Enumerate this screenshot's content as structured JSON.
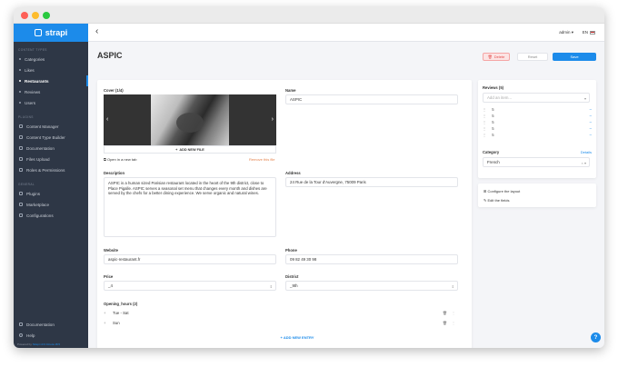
{
  "sidebar": {
    "brand": "strapi",
    "sections": {
      "content_types": "CONTENT TYPES",
      "plugins": "PLUGINS",
      "general": "GENERAL"
    },
    "content_types": [
      "Categories",
      "Likes",
      "Restaurants",
      "Reviews",
      "Users"
    ],
    "plugins": [
      "Content Manager",
      "Content Type Builder",
      "Documentation",
      "Files Upload",
      "Roles & Permissions"
    ],
    "general": [
      "Plugins",
      "Marketplace",
      "Configurations"
    ],
    "bottom": [
      "Documentation",
      "Help"
    ],
    "powered_prefix": "Powered by",
    "powered_link": "Strapi v3.0.0-beta.18.5"
  },
  "topbar": {
    "user": "admin",
    "lang": "EN"
  },
  "page": {
    "title": "ASPIC",
    "delete_label": "Delete",
    "reset_label": "Reset",
    "save_label": "Save"
  },
  "form": {
    "cover_label": "Cover (1/4)",
    "add_file_label": "ADD NEW FILE",
    "open_new_tab": "Open in a new tab",
    "remove_file": "Remove this file",
    "name_label": "Name",
    "name_value": "ASPIC",
    "description_label": "Description",
    "description_value": "ASPIC is a human sized Parisian restaurant located in the heart of the 9th district, close to Place Pigalle. ASPIC serves a seasonal set menu that changes every month and dishes are served by the chefs for a better dining experience. We serve organic and natural wines.",
    "address_label": "Address",
    "address_value": "24 Rue de la Tour d'Auvergne, 75009 Paris",
    "website_label": "Website",
    "website_value": "aspic-restaurant.fr",
    "phone_label": "Phone",
    "phone_value": "09 82 49 30 98",
    "price_label": "Price",
    "price_value": "_4",
    "district_label": "District",
    "district_value": "_9th",
    "opening_label": "Opening_hours (2)",
    "opening_entries": [
      "Tue - Sat",
      "Sun"
    ],
    "add_entry": "ADD NEW ENTRY"
  },
  "right": {
    "reviews_label": "Reviews (5)",
    "reviews_placeholder": "Add an item...",
    "reviews": [
      "5",
      "5",
      "5",
      "5",
      "5"
    ],
    "category_label": "Category",
    "category_details": "Details",
    "category_value": "French",
    "configure_layout": "Configure the layout",
    "edit_fields": "Edit the fields"
  }
}
